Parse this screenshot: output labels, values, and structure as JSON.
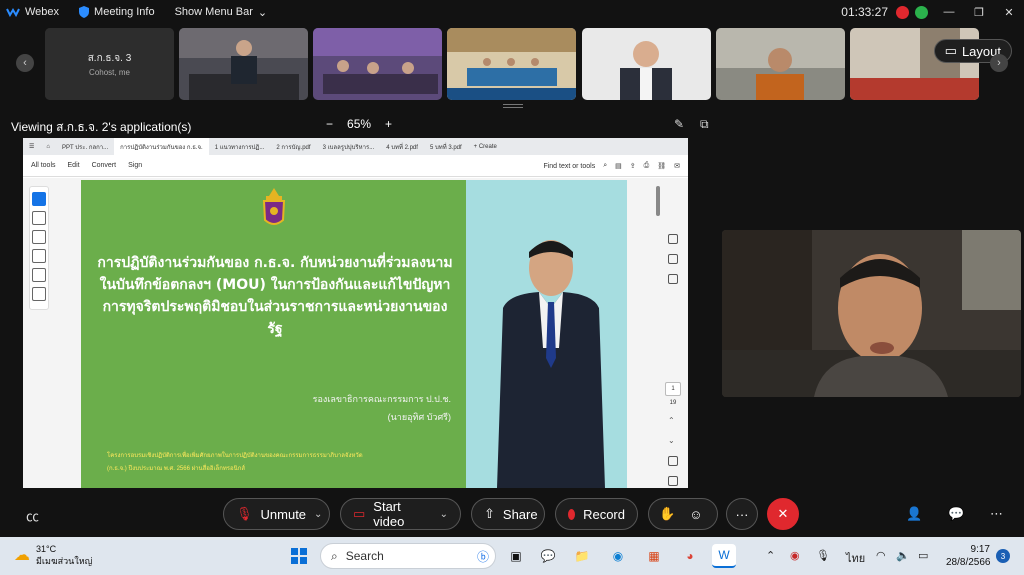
{
  "titlebar": {
    "app_name": "Webex",
    "meeting_info": "Meeting Info",
    "show_menu_bar": "Show Menu Bar",
    "clock": "01:33:27"
  },
  "strip": {
    "first_tile_name": "ส.ก.ธ.จ. 3",
    "first_tile_role": "Cohost, me",
    "layout_label": "Layout"
  },
  "viewing": {
    "label": "Viewing ส.ก.ธ.จ. 2's application(s)",
    "zoom_minus": "−",
    "zoom_level": "65%",
    "zoom_plus": "+"
  },
  "browser": {
    "tabs": [
      "PPT ประ. กลกา...",
      "การปฏิบัติงานร่วมกันของ ก.ธ.จ.",
      "1 แนวทางการปฏิ...",
      "2 การบัญ.pdf",
      "3 เบลลรูปปุบริหาร...",
      "4 บทที่ 2.pdf",
      "5 บทที่ 3.pdf"
    ],
    "create_label": "Create"
  },
  "acrobat": {
    "menu": [
      "All tools",
      "Edit",
      "Convert",
      "Sign"
    ],
    "find_label": "Find text or tools",
    "page_current": "1",
    "page_total": "19"
  },
  "slide": {
    "title": "การปฏิบัติงานร่วมกันของ ก.ธ.จ. กับหน่วยงานที่ร่วมลงนามในบันทึกข้อตกลงฯ (MOU) ในการป้องกันและแก้ไขปัญหาการทุจริตประพฤติมิชอบในส่วนราชการและหน่วยงานของรัฐ",
    "role_line1": "รองเลขาธิการคณะกรรมการ ป.ป.ช.",
    "role_line2": "(นายอุทิศ บัวศรี)",
    "footer_line1": "โครงการอบรมเชิงปฏิบัติการเพื่อเพิ่มศักยภาพในการปฏิบัติงานของคณะกรรมการธรรมาภิบาลจังหวัด",
    "footer_line2": "(ก.ธ.จ.) ปีงบประมาณ พ.ศ. 2566 ผ่านสื่ออิเล็กทรอนิกส์"
  },
  "controls": {
    "unmute": "Unmute",
    "start_video": "Start video",
    "share": "Share",
    "record": "Record",
    "more": "···"
  },
  "taskbar": {
    "temperature": "31°C",
    "weather_desc": "มีเมฆส่วนใหญ่",
    "search_placeholder": "Search",
    "language": "ไทย",
    "time": "9:17",
    "date": "28/8/2566",
    "notifications": "3"
  },
  "colors": {
    "slide_green": "#6bae4b",
    "slide_blue": "#a6dde0",
    "end_call": "#e0282e",
    "record_dot": "#e0282e"
  }
}
